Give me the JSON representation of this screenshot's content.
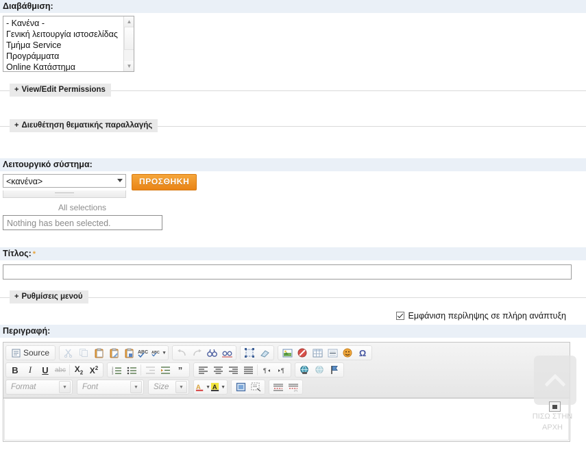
{
  "classification": {
    "label": "Διαβάθμιση:",
    "options": [
      "- Κανένα -",
      "Γενική λειτουργία ιστοσελίδας",
      "Τμήμα Service",
      "Προγράμματα",
      "Online Κατάστημα"
    ]
  },
  "fieldsets": [
    {
      "plus": "+",
      "label": "View/Edit Permissions"
    },
    {
      "plus": "+",
      "label": "Διευθέτηση θεματικής παραλλαγής"
    },
    {
      "plus": "+",
      "label": "Ρυθμίσεις μενού"
    }
  ],
  "operating_system": {
    "label": "Λειτουργικό σύστημα:",
    "selected": "<κανένα>",
    "add_button": "ΠΡΟΣΘΗΚΗ",
    "all_selections": "All selections",
    "nothing_selected": "Nothing has been selected."
  },
  "title_field": {
    "label": "Τίτλος:",
    "required_mark": "*",
    "value": "",
    "placeholder": ""
  },
  "summary": {
    "checkbox_label": "Εμφάνιση περίληψης σε πλήρη ανάπτυξη",
    "checked": true
  },
  "description": {
    "label": "Περιγραφή:",
    "body_text": ""
  },
  "editor": {
    "source_label": "Source",
    "toolbar_row1": [
      {
        "name": "source",
        "glyph": "▤",
        "label": "Source",
        "disabled": false
      },
      {
        "name": "cut",
        "glyph": "✂",
        "label": "",
        "disabled": true
      },
      {
        "name": "copy",
        "glyph": "❐",
        "label": "",
        "disabled": true
      },
      {
        "name": "paste",
        "glyph": "📋",
        "label": "",
        "disabled": false
      },
      {
        "name": "paste-as-plain-text",
        "glyph": "📋",
        "label": "",
        "disabled": false
      },
      {
        "name": "paste-from-word",
        "glyph": "📋",
        "label": "",
        "disabled": false
      },
      {
        "name": "spell-check",
        "glyph": "ABC",
        "label": "",
        "disabled": false
      },
      {
        "name": "spell-check-options",
        "glyph": "ABC",
        "label": "",
        "disabled": false
      },
      {
        "name": "undo",
        "glyph": "↰",
        "label": "",
        "disabled": true
      },
      {
        "name": "redo",
        "glyph": "↱",
        "label": "",
        "disabled": true
      },
      {
        "name": "find",
        "glyph": "🔍",
        "label": "",
        "disabled": false
      },
      {
        "name": "replace",
        "glyph": "⇄",
        "label": "",
        "disabled": false
      },
      {
        "name": "select-all",
        "glyph": "⬚",
        "label": "",
        "disabled": false
      },
      {
        "name": "remove-format",
        "glyph": "⌫",
        "label": "",
        "disabled": false
      },
      {
        "name": "image",
        "glyph": "🖼",
        "label": "",
        "disabled": false
      },
      {
        "name": "media-break",
        "glyph": "⛒",
        "label": "",
        "disabled": false
      },
      {
        "name": "table",
        "glyph": "▦",
        "label": "",
        "disabled": false
      },
      {
        "name": "horizontal-rule",
        "glyph": "▤",
        "label": "",
        "disabled": false
      },
      {
        "name": "smiley",
        "glyph": "☺",
        "label": "",
        "disabled": false
      },
      {
        "name": "special-character",
        "glyph": "Ω",
        "label": "",
        "disabled": false
      }
    ],
    "toolbar_row2": [
      {
        "name": "bold",
        "glyph": "B",
        "disabled": false
      },
      {
        "name": "italic",
        "glyph": "I",
        "disabled": false
      },
      {
        "name": "underline",
        "glyph": "U",
        "disabled": false
      },
      {
        "name": "strikethrough",
        "glyph": "abc",
        "disabled": true
      },
      {
        "name": "subscript",
        "glyph": "X₂",
        "disabled": false
      },
      {
        "name": "superscript",
        "glyph": "X²",
        "disabled": false
      },
      {
        "name": "numbered-list",
        "glyph": "≡",
        "disabled": false
      },
      {
        "name": "bulleted-list",
        "glyph": "≔",
        "disabled": false
      },
      {
        "name": "decrease-indent",
        "glyph": "⇤",
        "disabled": true
      },
      {
        "name": "increase-indent",
        "glyph": "⇥",
        "disabled": false
      },
      {
        "name": "blockquote",
        "glyph": "❞",
        "disabled": false
      },
      {
        "name": "align-left",
        "glyph": "≡",
        "disabled": false
      },
      {
        "name": "align-center",
        "glyph": "≡",
        "disabled": false
      },
      {
        "name": "align-right",
        "glyph": "≡",
        "disabled": false
      },
      {
        "name": "justify",
        "glyph": "≡",
        "disabled": false
      },
      {
        "name": "text-direction-ltr",
        "glyph": "¶",
        "disabled": false
      },
      {
        "name": "text-direction-rtl",
        "glyph": "¶",
        "disabled": false
      },
      {
        "name": "link",
        "glyph": "🌐",
        "disabled": false
      },
      {
        "name": "unlink",
        "glyph": "🌐",
        "disabled": true
      },
      {
        "name": "anchor",
        "glyph": "⚑",
        "disabled": false
      }
    ],
    "combos": [
      {
        "name": "format",
        "label": "Format"
      },
      {
        "name": "font",
        "label": "Font"
      },
      {
        "name": "size",
        "label": "Size"
      }
    ],
    "toolbar_row3_extra": [
      {
        "name": "text-color",
        "glyph": "A",
        "disabled": false
      },
      {
        "name": "background-color",
        "glyph": "A",
        "disabled": false
      },
      {
        "name": "maximize",
        "glyph": "⛶",
        "disabled": false
      },
      {
        "name": "show-blocks",
        "glyph": "▣",
        "disabled": false
      },
      {
        "name": "cke-styles",
        "glyph": "≡",
        "disabled": false
      },
      {
        "name": "cke-templates",
        "glyph": "≡",
        "disabled": false
      }
    ]
  },
  "back_to_top": {
    "line1": "ΠΙΣΩ ΣΤΗΝ",
    "line2": "ΑΡΧΗ"
  },
  "colors": {
    "band": "#eaf0f7",
    "accent_orange": "#ee8e1c",
    "legend_bg": "#e9e9e9",
    "required": "#e7a33c"
  }
}
